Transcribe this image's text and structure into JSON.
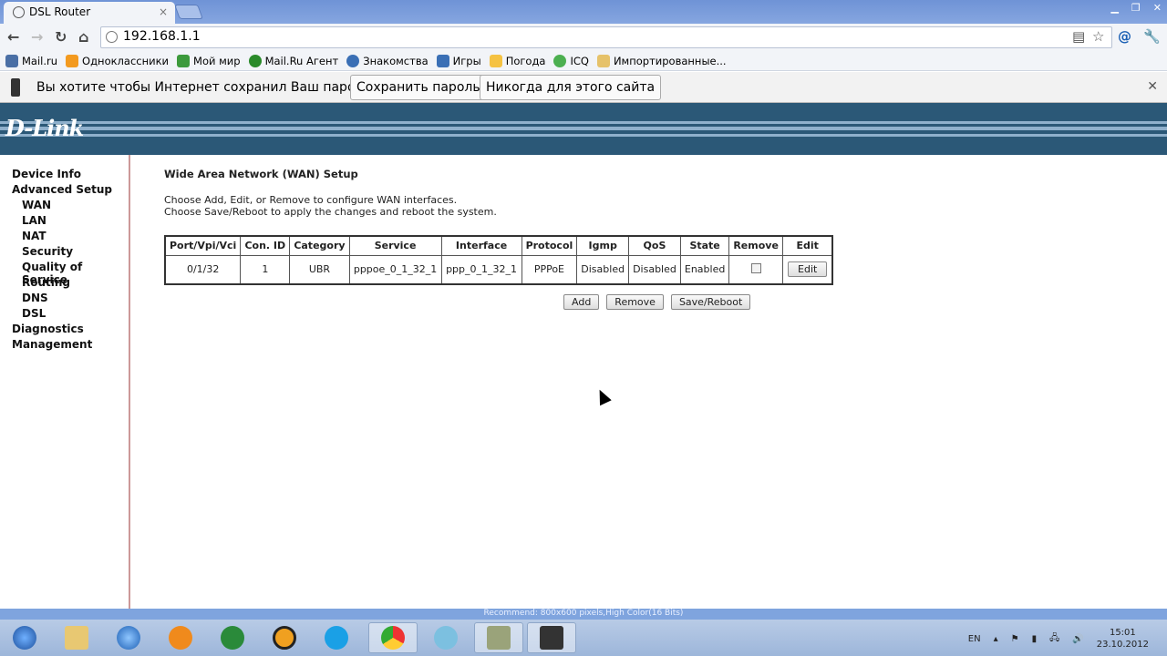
{
  "browser": {
    "tab_title": "DSL Router",
    "address": "192.168.1.1",
    "bookmarks": [
      "Mail.ru",
      "Одноклассники",
      "Мой мир",
      "Mail.Ru Агент",
      "Знакомства",
      "Игры",
      "Погода",
      "ICQ",
      "Импортированные..."
    ],
    "bookmark_colors": [
      "#4a6fa5",
      "#f39a1f",
      "#3c9a3c",
      "#2a8a2a",
      "#3a6fb5",
      "#3a6fb5",
      "#f5c242",
      "#4caf50",
      "#e6c26a"
    ],
    "infobar": {
      "message": "Вы хотите чтобы Интернет сохранил Ваш пароль?",
      "save": "Сохранить пароль",
      "never": "Никогда для этого сайта"
    }
  },
  "brand": {
    "logo": "D-Link",
    "banner_color": "#2b5877"
  },
  "sidebar": [
    {
      "label": "Device Info",
      "sub": false
    },
    {
      "label": "Advanced Setup",
      "sub": false
    },
    {
      "label": "WAN",
      "sub": true
    },
    {
      "label": "LAN",
      "sub": true
    },
    {
      "label": "NAT",
      "sub": true
    },
    {
      "label": "Security",
      "sub": true
    },
    {
      "label": "Quality of Service",
      "sub": true
    },
    {
      "label": "Routing",
      "sub": true
    },
    {
      "label": "DNS",
      "sub": true
    },
    {
      "label": "DSL",
      "sub": true
    },
    {
      "label": "Diagnostics",
      "sub": false
    },
    {
      "label": "Management",
      "sub": false
    }
  ],
  "main": {
    "title": "Wide Area Network (WAN) Setup",
    "desc1": "Choose Add, Edit, or Remove to configure WAN interfaces.",
    "desc2": "Choose Save/Reboot to apply the changes and reboot the system.",
    "headers": [
      "Port/Vpi/Vci",
      "Con. ID",
      "Category",
      "Service",
      "Interface",
      "Protocol",
      "Igmp",
      "QoS",
      "State",
      "Remove",
      "Edit"
    ],
    "rows": [
      {
        "port": "0/1/32",
        "con_id": "1",
        "category": "UBR",
        "service": "pppoe_0_1_32_1",
        "interface": "ppp_0_1_32_1",
        "protocol": "PPPoE",
        "igmp": "Disabled",
        "qos": "Disabled",
        "state": "Enabled",
        "remove_checked": false,
        "edit": "Edit"
      }
    ],
    "add": "Add",
    "remove": "Remove",
    "save_reboot": "Save/Reboot"
  },
  "status": "Recommend: 800x600 pixels,High Color(16 Bits)",
  "taskbar": {
    "lang": "EN",
    "time": "15:01",
    "date": "23.10.2012"
  }
}
